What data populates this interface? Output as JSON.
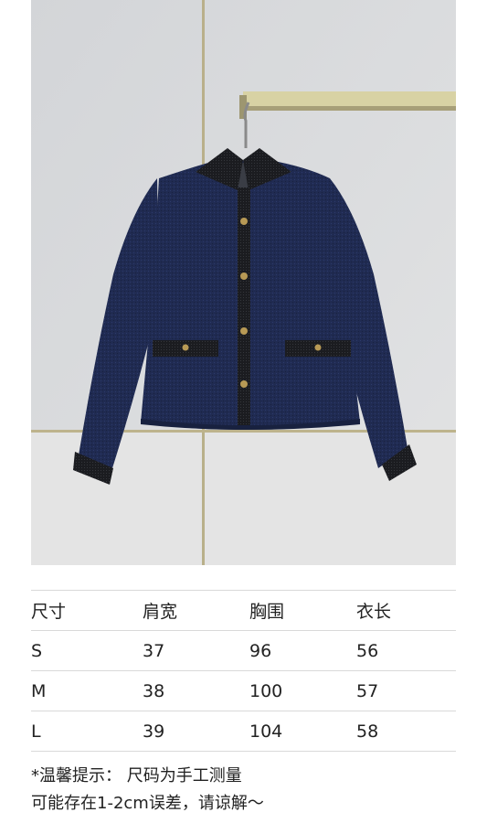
{
  "table": {
    "headers": [
      "尺寸",
      "肩宽",
      "胸围",
      "衣长"
    ],
    "rows": [
      [
        "S",
        "37",
        "96",
        "56"
      ],
      [
        "M",
        "38",
        "100",
        "57"
      ],
      [
        "L",
        "39",
        "104",
        "58"
      ]
    ]
  },
  "note": {
    "line1": "*温馨提示：  尺码为手工测量",
    "line2": "可能存在1-2cm误差，请谅解～"
  },
  "colors": {
    "jacket": "#1f2a4f",
    "trim": "#1d1e22",
    "wall": "#d9dadc",
    "rail": "#d6cf9f"
  }
}
